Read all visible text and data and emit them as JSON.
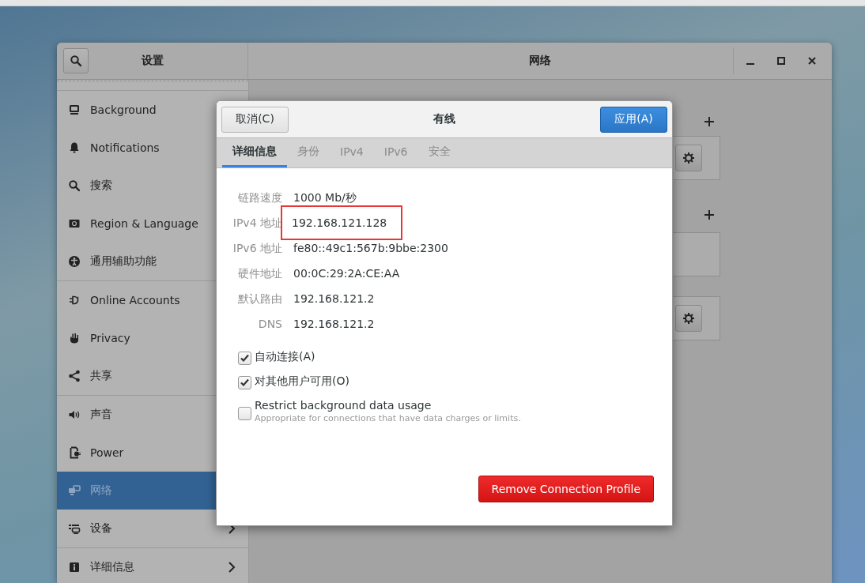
{
  "window": {
    "title": "设置",
    "panel_title": "网络"
  },
  "sidebar": {
    "items": [
      {
        "label": "Background",
        "selected": false
      },
      {
        "label": "Notifications",
        "selected": false
      },
      {
        "label": "搜索",
        "selected": false
      },
      {
        "label": "Region & Language",
        "selected": false
      },
      {
        "label": "通用辅助功能",
        "selected": false,
        "divider_after": true
      },
      {
        "label": "Online Accounts",
        "selected": false
      },
      {
        "label": "Privacy",
        "selected": false
      },
      {
        "label": "共享",
        "selected": false,
        "divider_after": true
      },
      {
        "label": "声音",
        "selected": false
      },
      {
        "label": "Power",
        "selected": false
      },
      {
        "label": "网络",
        "selected": true
      },
      {
        "label": "设备",
        "selected": false,
        "chevron": true,
        "divider_after": true
      },
      {
        "label": "详细信息",
        "selected": false,
        "chevron": true
      }
    ]
  },
  "dialog": {
    "title": "有线",
    "cancel": "取消(C)",
    "apply": "应用(A)",
    "tabs": [
      {
        "label": "详细信息",
        "selected": true
      },
      {
        "label": "身份",
        "selected": false
      },
      {
        "label": "IPv4",
        "selected": false
      },
      {
        "label": "IPv6",
        "selected": false
      },
      {
        "label": "安全",
        "selected": false
      }
    ],
    "details": [
      {
        "label": "链路速度",
        "value": "1000 Mb/秒"
      },
      {
        "label": "IPv4 地址",
        "value": "192.168.121.128",
        "highlighted": true
      },
      {
        "label": "IPv6 地址",
        "value": "fe80::49c1:567b:9bbe:2300"
      },
      {
        "label": "硬件地址",
        "value": "00:0C:29:2A:CE:AA"
      },
      {
        "label": "默认路由",
        "value": "192.168.121.2"
      },
      {
        "label": "DNS",
        "value": "192.168.121.2"
      }
    ],
    "options": [
      {
        "label": "自动连接(A)",
        "checked": true
      },
      {
        "label": "对其他用户可用(O)",
        "checked": true
      },
      {
        "label": "Restrict background data usage",
        "description": "Appropriate for connections that have data charges or limits.",
        "checked": false
      }
    ],
    "remove_button": "Remove Connection Profile"
  }
}
